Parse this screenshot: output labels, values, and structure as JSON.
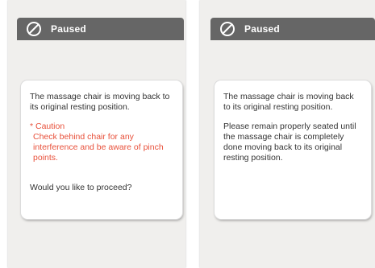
{
  "left_panel": {
    "header_title": "Paused",
    "message": "The massage chair is moving back to its original resting position.",
    "caution_title": "* Caution",
    "caution_detail": "Check behind chair for any interference and be aware of pinch points.",
    "question": "Would you like to proceed?"
  },
  "right_panel": {
    "header_title": "Paused",
    "message": "The massage chair is moving back to its original resting position.",
    "instruction": "Please remain properly seated until the massage chair is completely done moving back to its original resting position."
  },
  "colors": {
    "header_bg": "#666666",
    "caution": "#e8503a",
    "panel_bg": "#f0efed"
  },
  "icons": {
    "header_icon": "paused-icon"
  }
}
